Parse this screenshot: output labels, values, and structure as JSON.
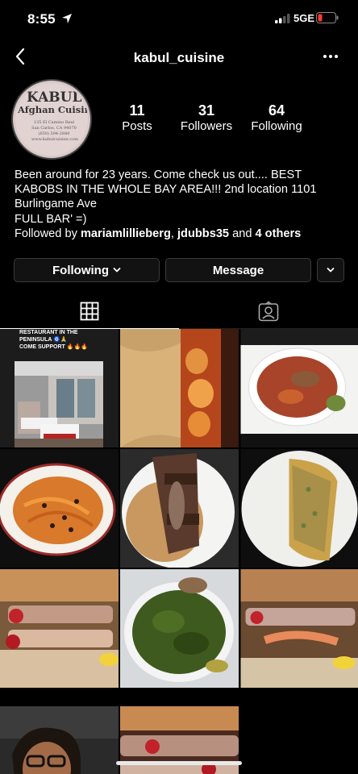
{
  "status_bar": {
    "time": "8:55",
    "network": "5GE"
  },
  "header": {
    "handle": "kabul_cuisine"
  },
  "avatar": {
    "logo_title": "KABUL",
    "logo_subtitle": "Afghan Cuisine",
    "logo_address": "135 El Camino Real San Carlos, CA 94070 (650) 594-2840 www.kabulcuisine.com"
  },
  "stats": [
    {
      "value": "11",
      "label": "Posts"
    },
    {
      "value": "31",
      "label": "Followers"
    },
    {
      "value": "64",
      "label": "Following"
    }
  ],
  "bio": {
    "text": "Been around for 23 years. Come check us out.... BEST KABOBS IN THE WHOLE BAY AREA!!! 2nd location 1101 Burlingame Ave\nFULL BAR' =)",
    "followed_prefix": "Followed by ",
    "followed_user1": "mariamlillieberg",
    "followed_sep": ", ",
    "followed_user2": "jdubbs35",
    "followed_and": " and ",
    "followed_others": "4 others"
  },
  "buttons": {
    "following": "Following",
    "message": "Message"
  },
  "tabs": [
    {
      "icon": "grid-icon",
      "active": true
    },
    {
      "icon": "tagged-icon",
      "active": false
    }
  ],
  "post_caption": {
    "line1": "RESTAURANT IN THE",
    "line2": "PENINSULA 🧿🙏",
    "line3": "COME SUPPORT 🔥🔥🔥"
  },
  "colors": {
    "background": "#000000",
    "button_bg": "#121212",
    "button_border": "#3a3a3a",
    "battery_low": "#ff3b30"
  }
}
